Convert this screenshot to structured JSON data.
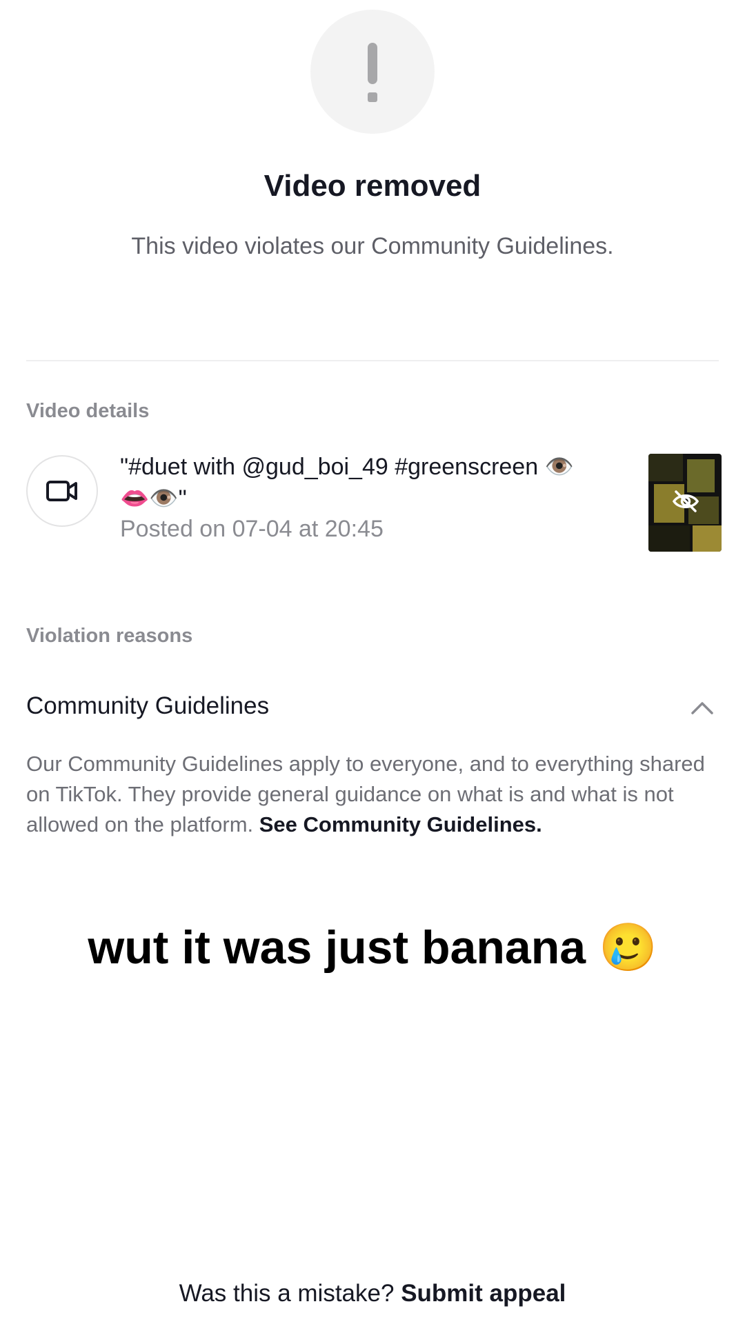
{
  "header": {
    "icon": "exclamation-icon",
    "title": "Video removed",
    "subtitle": "This video violates our Community Guidelines."
  },
  "video_details": {
    "section_label": "Video details",
    "icon": "video-camera-icon",
    "caption_line1": "\"#duet with @gud_boi_49 #greenscreen 👁️",
    "caption_line2": "👄👁️\"",
    "posted": "Posted on 07-04 at 20:45",
    "thumbnail_icon": "eye-slash-icon"
  },
  "violation": {
    "section_label": "Violation reasons",
    "reason_title": "Community Guidelines",
    "expand_icon": "chevron-up-icon",
    "description": "Our Community Guidelines apply to everyone, and to everything shared on TikTok. They provide general guidance on what is and what is not allowed on the platform. ",
    "link_text": "See Community Guidelines."
  },
  "overlay_caption": "wut it was just banana 🥲",
  "footer": {
    "question": "Was this a mistake? ",
    "appeal_link": "Submit appeal"
  }
}
